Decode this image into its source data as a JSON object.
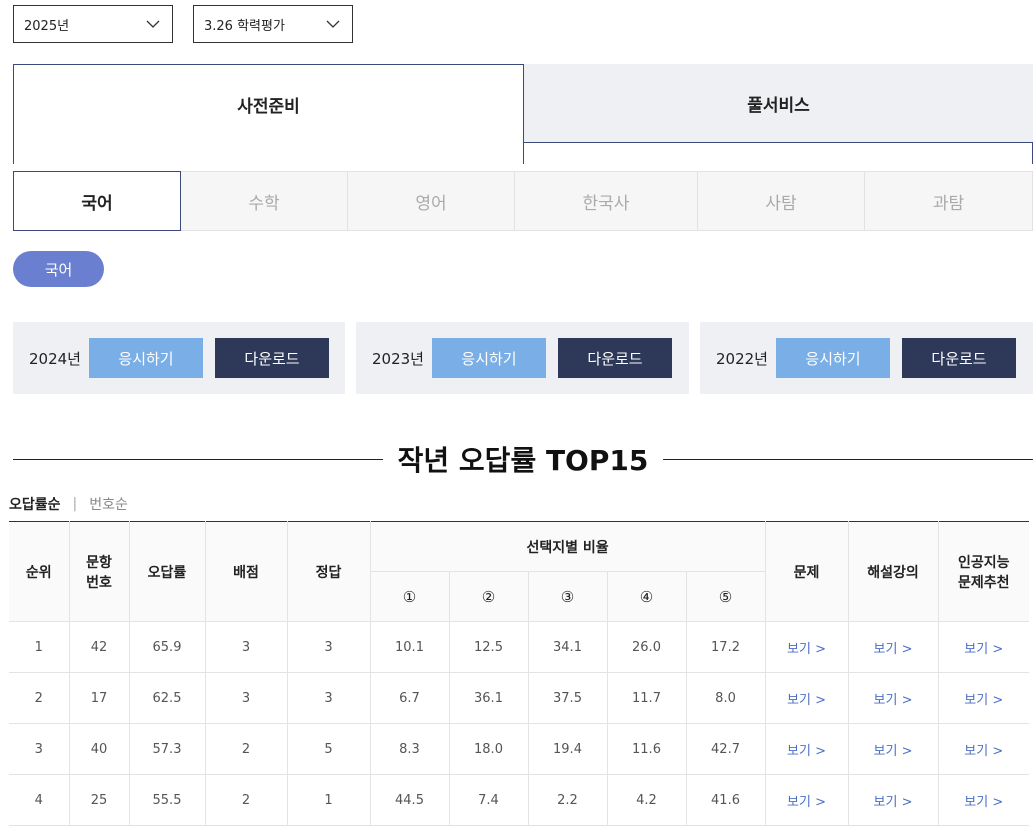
{
  "filters": {
    "year": "2025년",
    "exam": "3.26 학력평가"
  },
  "main_tabs": {
    "prep": "사전준비",
    "full": "풀서비스"
  },
  "subject_tabs": [
    "국어",
    "수학",
    "영어",
    "한국사",
    "사탐",
    "과탐"
  ],
  "subsubject": "국어",
  "past_exams": [
    {
      "year": "2024년",
      "try_label": "응시하기",
      "download_label": "다운로드"
    },
    {
      "year": "2023년",
      "try_label": "응시하기",
      "download_label": "다운로드"
    },
    {
      "year": "2022년",
      "try_label": "응시하기",
      "download_label": "다운로드"
    }
  ],
  "section_title": "작년 오답률 TOP15",
  "sort": {
    "active": "오답률순",
    "inactive": "번호순"
  },
  "table": {
    "headers": {
      "rank": "순위",
      "number": "문항\n번호",
      "wrong_rate": "오답률",
      "score": "배점",
      "answer": "정답",
      "choice_ratio": "선택지별 비율",
      "problem": "문제",
      "lecture": "해설강의",
      "ai": "인공지능\n문제추천"
    },
    "choices": [
      "①",
      "②",
      "③",
      "④",
      "⑤"
    ],
    "rows": [
      {
        "rank": "1",
        "number": "42",
        "wrong_rate": "65.9",
        "score": "3",
        "answer": "3",
        "c": [
          "10.1",
          "12.5",
          "34.1",
          "26.0",
          "17.2"
        ],
        "problem": "보기 >",
        "lecture": "보기 >",
        "ai": "보기 >"
      },
      {
        "rank": "2",
        "number": "17",
        "wrong_rate": "62.5",
        "score": "3",
        "answer": "3",
        "c": [
          "6.7",
          "36.1",
          "37.5",
          "11.7",
          "8.0"
        ],
        "problem": "보기 >",
        "lecture": "보기 >",
        "ai": "보기 >"
      },
      {
        "rank": "3",
        "number": "40",
        "wrong_rate": "57.3",
        "score": "2",
        "answer": "5",
        "c": [
          "8.3",
          "18.0",
          "19.4",
          "11.6",
          "42.7"
        ],
        "problem": "보기 >",
        "lecture": "보기 >",
        "ai": "보기 >"
      },
      {
        "rank": "4",
        "number": "25",
        "wrong_rate": "55.5",
        "score": "2",
        "answer": "1",
        "c": [
          "44.5",
          "7.4",
          "2.2",
          "4.2",
          "41.6"
        ],
        "problem": "보기 >",
        "lecture": "보기 >",
        "ai": "보기 >"
      }
    ]
  }
}
